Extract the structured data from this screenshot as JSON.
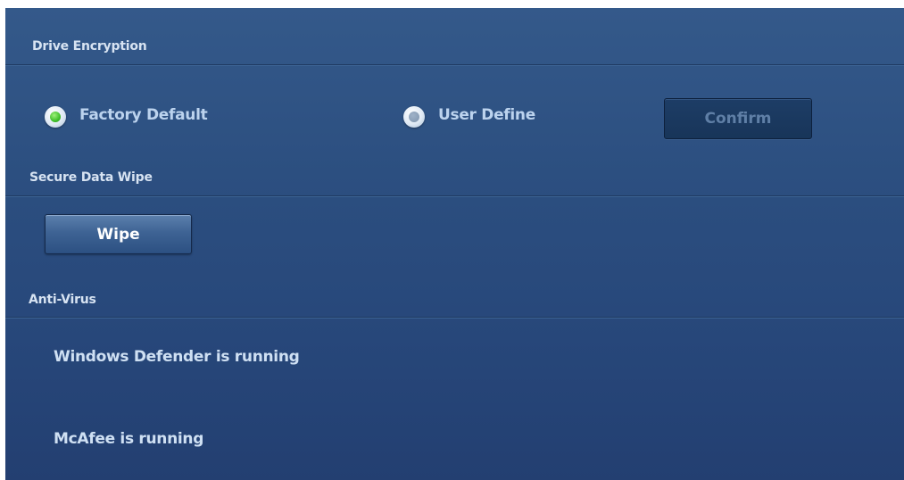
{
  "drive_encryption": {
    "title": "Drive Encryption",
    "options": [
      {
        "label": "Factory Default",
        "selected": true
      },
      {
        "label": "User Define",
        "selected": false
      }
    ],
    "confirm_label": "Confirm",
    "confirm_enabled": false
  },
  "secure_data_wipe": {
    "title": "Secure Data Wipe",
    "wipe_label": "Wipe"
  },
  "anti_virus": {
    "title": "Anti-Virus",
    "statuses": [
      "Windows Defender is running",
      "McAfee is running"
    ]
  },
  "colors": {
    "panel_background": "#2c4f80",
    "radio_selected": "#3fbf2a",
    "text": "#bcd3ee"
  }
}
